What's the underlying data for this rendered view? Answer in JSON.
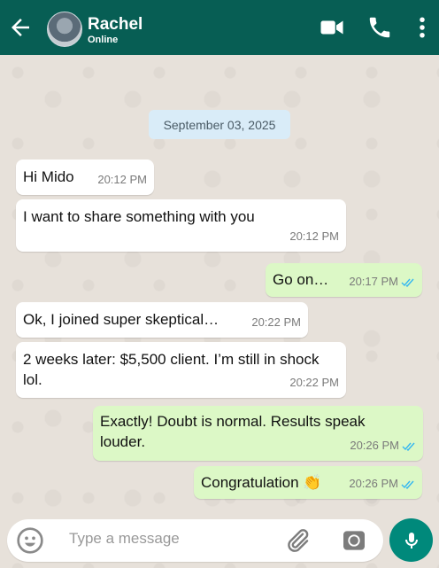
{
  "header": {
    "name": "Rachel",
    "status": "Online"
  },
  "date_chip": "September 03, 2025",
  "messages": [
    {
      "text": "Hi Mido",
      "time": "20:12 PM",
      "direction": "in"
    },
    {
      "text": "I want to share something with you",
      "time": "20:12 PM",
      "direction": "in"
    },
    {
      "text": "Go on…",
      "time": "20:17 PM",
      "direction": "out"
    },
    {
      "text": "Ok, I joined super skeptical…",
      "time": "20:22 PM",
      "direction": "in"
    },
    {
      "text": "2 weeks later: $5,500 client. I’m still in shock lol.",
      "time": "20:22 PM",
      "direction": "in"
    },
    {
      "text": "Exactly! Doubt is normal. Results speak louder.",
      "time": "20:26 PM",
      "direction": "out"
    },
    {
      "text": "Congratulation 👏",
      "time": "20:26 PM",
      "direction": "out"
    }
  ],
  "input": {
    "placeholder": "Type a message"
  },
  "icons": {
    "back": "arrow-left-icon",
    "video": "video-camera-icon",
    "phone": "phone-icon",
    "more": "more-vertical-icon",
    "emoji": "emoji-icon",
    "attach": "paperclip-icon",
    "camera": "camera-icon",
    "mic": "microphone-icon"
  },
  "colors": {
    "header": "#075e54",
    "outgoing_bubble": "#dcf8c6",
    "incoming_bubble": "#ffffff",
    "date_chip": "#d9ecf8",
    "mic_button": "#00897b",
    "read_ticks": "#34b7f1"
  }
}
